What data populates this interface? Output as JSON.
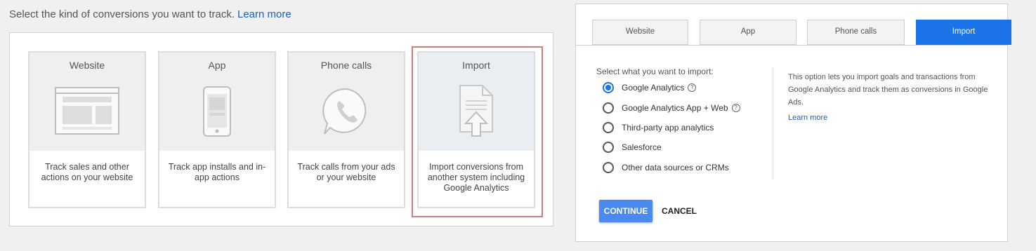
{
  "left": {
    "heading": "Select the kind of conversions you want to track.",
    "learn_more": "Learn more",
    "cards": [
      {
        "title": "Website",
        "desc": "Track sales and other actions on your website"
      },
      {
        "title": "App",
        "desc": "Track app installs and in-app actions"
      },
      {
        "title": "Phone calls",
        "desc": "Track calls from your ads or your website"
      },
      {
        "title": "Import",
        "desc": "Import conversions from another system including Google Analytics"
      }
    ]
  },
  "right": {
    "tabs": [
      "Website",
      "App",
      "Phone calls",
      "Import"
    ],
    "active_tab": "Import",
    "section_label": "Select what you want to import:",
    "options": [
      {
        "label": "Google Analytics",
        "selected": true,
        "help": true
      },
      {
        "label": "Google Analytics App + Web",
        "selected": false,
        "help": true
      },
      {
        "label": "Third-party app analytics",
        "selected": false,
        "help": false
      },
      {
        "label": "Salesforce",
        "selected": false,
        "help": false
      },
      {
        "label": "Other data sources or CRMs",
        "selected": false,
        "help": false
      }
    ],
    "info_text": "This option lets you import goals and transactions from Google Analytics and track them as conversions in Google Ads.",
    "info_link": "Learn more",
    "continue_label": "CONTINUE",
    "cancel_label": "CANCEL"
  },
  "colors": {
    "accent": "#1a73e8",
    "highlight_outline": "#d47a7a"
  },
  "help_glyph": "?"
}
